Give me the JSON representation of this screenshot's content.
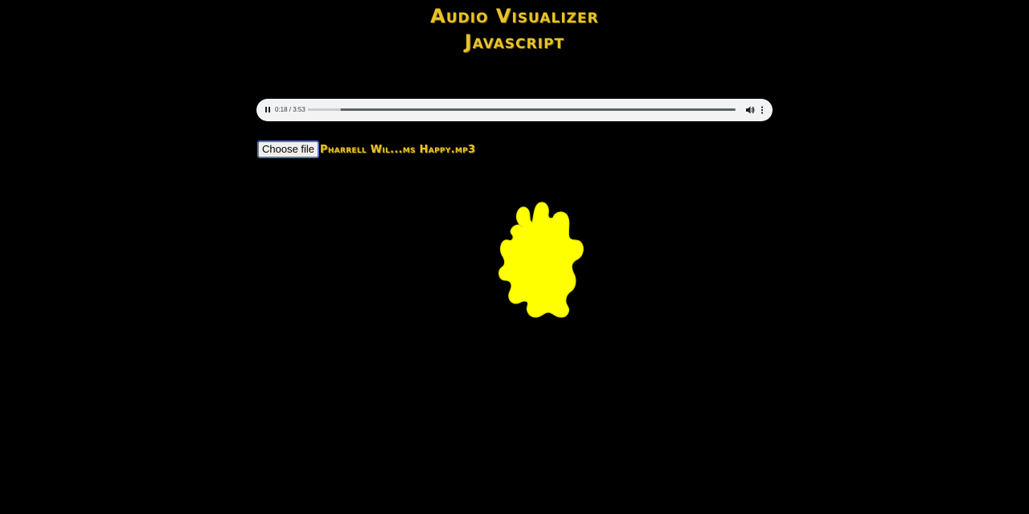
{
  "header": {
    "title_line1": "Audio Visualizer",
    "title_line2": "Javascript"
  },
  "audio_player": {
    "time_display": "0:18 / 3:53",
    "progress": 0.077,
    "state": "playing",
    "controls": {
      "play_pause_icon": "pause-icon",
      "volume_icon": "volume-icon",
      "more_icon": "more-vertical-icon"
    }
  },
  "file_input": {
    "button_label": "Choose file",
    "file_name": "Pharrell Wil...ms Happy.mp3"
  },
  "visualizer": {
    "shape": "splat-blob",
    "color": "#ffff00"
  },
  "colors": {
    "background": "#000000",
    "accent": "#e8c32a",
    "player_bg": "#f1f3f4"
  }
}
